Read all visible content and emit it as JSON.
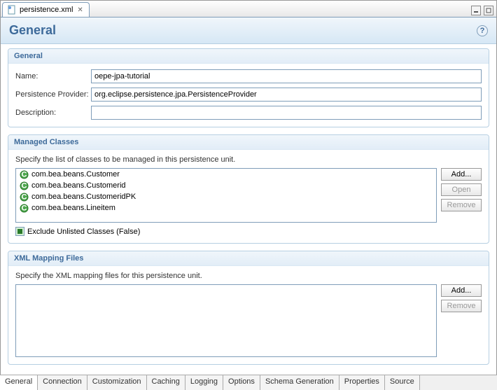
{
  "tab": {
    "filename": "persistence.xml"
  },
  "pageTitle": "General",
  "sections": {
    "general": {
      "title": "General",
      "nameLabel": "Name:",
      "nameValue": "oepe-jpa-tutorial",
      "providerLabel": "Persistence Provider:",
      "providerValue": "org.eclipse.persistence.jpa.PersistenceProvider",
      "descriptionLabel": "Description:",
      "descriptionValue": ""
    },
    "managedClasses": {
      "title": "Managed Classes",
      "help": "Specify the list of classes to be managed in this persistence unit.",
      "items": [
        "com.bea.beans.Customer",
        "com.bea.beans.Customerid",
        "com.bea.beans.CustomeridPK",
        "com.bea.beans.Lineitem"
      ],
      "buttons": {
        "add": "Add...",
        "open": "Open",
        "remove": "Remove"
      },
      "excludeLabel": "Exclude Unlisted Classes (False)"
    },
    "xmlMapping": {
      "title": "XML Mapping Files",
      "help": "Specify the XML mapping files for this persistence unit.",
      "buttons": {
        "add": "Add...",
        "remove": "Remove"
      }
    }
  },
  "bottomTabs": [
    "General",
    "Connection",
    "Customization",
    "Caching",
    "Logging",
    "Options",
    "Schema Generation",
    "Properties",
    "Source"
  ]
}
